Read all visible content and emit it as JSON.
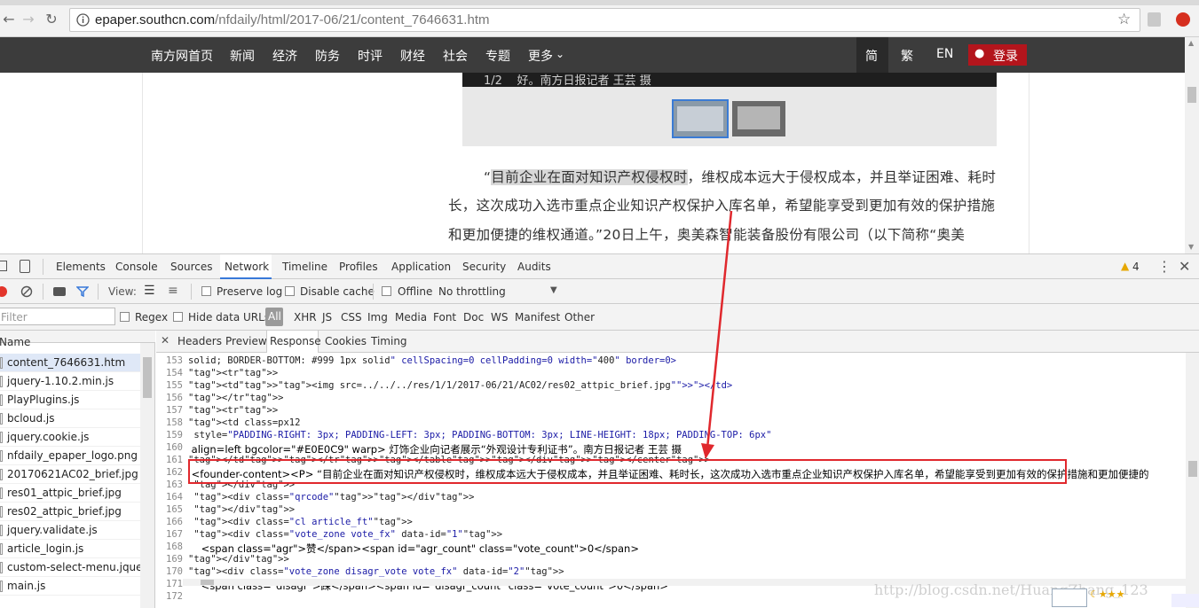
{
  "browser": {
    "url_host": "epaper.southcn.com",
    "url_path": "/nfdaily/html/2017-06/21/content_7646631.htm"
  },
  "site_nav": {
    "links": [
      "南方网首页",
      "新闻",
      "经济",
      "防务",
      "时评",
      "财经",
      "社会",
      "专题",
      "更多"
    ],
    "lang": [
      "简",
      "繁",
      "EN"
    ],
    "login": "登录"
  },
  "slide": {
    "caption": "1/2    好。南方日报记者 王芸 摄"
  },
  "article": {
    "line1_pre": "“",
    "line1_hl": "目前企业在面对知识产权侵权时",
    "line1_post": "，维权成本远大于侵权成本，并且举证困难、耗时",
    "line2": "长，这次成功入选市重点企业知识产权保护入库名单，希望能享受到更加有效的保护措施",
    "line3": "和更加便捷的维权通道。”20日上午，奥美森智能装备股份有限公司（以下简称“奥美"
  },
  "devtools": {
    "tabs": [
      "Elements",
      "Console",
      "Sources",
      "Network",
      "Timeline",
      "Profiles",
      "Application",
      "Security",
      "Audits"
    ],
    "active_tab": "Network",
    "warnings": "4",
    "toolbar": {
      "view_label": "View:",
      "preserve_log": "Preserve log",
      "disable_cache": "Disable cache",
      "offline": "Offline",
      "throttling": "No throttling"
    },
    "filter": {
      "placeholder": "Filter",
      "regex": "Regex",
      "hide_data_urls": "Hide data URLs",
      "types": [
        "All",
        "XHR",
        "JS",
        "CSS",
        "Img",
        "Media",
        "Font",
        "Doc",
        "WS",
        "Manifest",
        "Other"
      ]
    },
    "list_header": "Name",
    "files": [
      "content_7646631.htm",
      "jquery-1.10.2.min.js",
      "PlayPlugins.js",
      "bcloud.js",
      "jquery.cookie.js",
      "nfdaily_epaper_logo.png",
      "20170621AC02_brief.jpg",
      "res01_attpic_brief.jpg",
      "res02_attpic_brief.jpg",
      "jquery.validate.js",
      "article_login.js",
      "custom-select-menu.jquery.js",
      "main.js"
    ],
    "response_tabs": [
      "Headers",
      "Preview",
      "Response",
      "Cookies",
      "Timing"
    ],
    "active_response_tab": "Response",
    "code_lines": [
      {
        "n": "153",
        "t": "solid; BORDER-BOTTOM: #999 1px solid\" cellSpacing=0 cellPadding=0 width=\"400\" border=0>"
      },
      {
        "n": "154",
        "t": "<tr>"
      },
      {
        "n": "155",
        "t": "<td><img src=../../../res/1/1/2017-06/21/AC02/res02_attpic_brief.jpg\"></td>"
      },
      {
        "n": "156",
        "t": "</tr>"
      },
      {
        "n": "157",
        "t": "<tr>"
      },
      {
        "n": "158",
        "t": "<td class=px12"
      },
      {
        "n": "159",
        "t": " style=\"PADDING-RIGHT: 3px; PADDING-LEFT: 3px; PADDING-BOTTOM: 3px; LINE-HEIGHT: 18px; PADDING-TOP: 6px\""
      },
      {
        "n": "160",
        "t": " align=left bgcolor=\"#E0E0C9\" warp> 灯饰企业向记者展示“外观设计专利证书”。南方日报记者 王芸 摄"
      },
      {
        "n": "161",
        "t": "</td></tr></table></div></center>"
      },
      {
        "n": "162",
        "t": " <founder-content><P> “目前企业在面对知识产权侵权时，维权成本远大于侵权成本，并且举证困难、耗时长，这次成功入选市重点企业知识产权保护入库名单，希望能享受到更加有效的保护措施和更加便捷的"
      },
      {
        "n": "163",
        "t": " </div>"
      },
      {
        "n": "164",
        "t": " <div class=\"qrcode\"></div>"
      },
      {
        "n": "165",
        "t": " </div>"
      },
      {
        "n": "166",
        "t": " <div class=\"cl article_ft\">"
      },
      {
        "n": "167",
        "t": " <div class=\"vote_zone vote_fx\" data-id=\"1\">"
      },
      {
        "n": "168",
        "t": "    <span class=\"agr\">赞</span><span id=\"agr_count\" class=\"vote_count\">0</span>"
      },
      {
        "n": "169",
        "t": "</div>"
      },
      {
        "n": "170",
        "t": "<div class=\"vote_zone disagr_vote vote_fx\" data-id=\"2\">"
      },
      {
        "n": "171",
        "t": "    <span class=\"disagr\">踩</span><span id=\"disagr_count\" class=\"vote_count\">0</span>"
      },
      {
        "n": "172",
        "t": ""
      }
    ]
  },
  "watermark": "http://blog.csdn.net/HuangZhang_123",
  "colors": {
    "accent_red": "#e0282d",
    "nav_bg": "#3c3c3c",
    "login_bg": "#b3151c"
  }
}
